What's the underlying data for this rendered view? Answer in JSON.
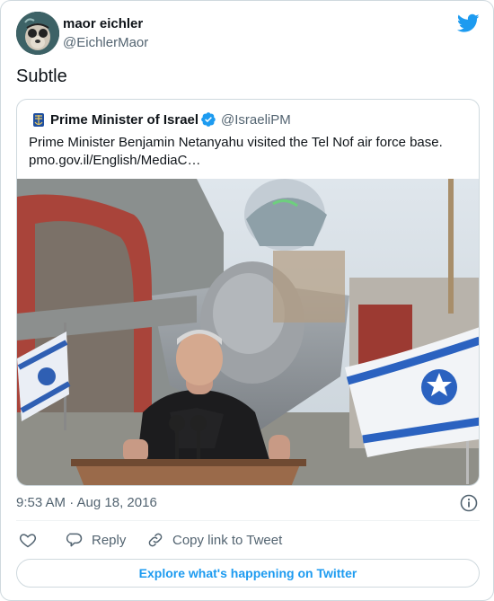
{
  "author": {
    "name": "maor eichler",
    "handle": "@EichlerMaor"
  },
  "tweet": {
    "text": "Subtle"
  },
  "quoted": {
    "name": "Prime Minister of Israel",
    "handle": "@IsraeliPM",
    "text_line1": "Prime Minister Benjamin Netanyahu visited the Tel Nof air force base.",
    "text_line2": "pmo.gov.il/English/MediaC…",
    "verified": true
  },
  "meta": {
    "timestamp": "9:53 AM · Aug 18, 2016"
  },
  "actions": {
    "reply_label": "Reply",
    "copy_label": "Copy link to Tweet"
  },
  "explore": {
    "label": "Explore what's happening on Twitter"
  },
  "colors": {
    "brand": "#1d9bf0",
    "text": "#0f1419",
    "muted": "#536471",
    "border": "#cfd9de"
  }
}
